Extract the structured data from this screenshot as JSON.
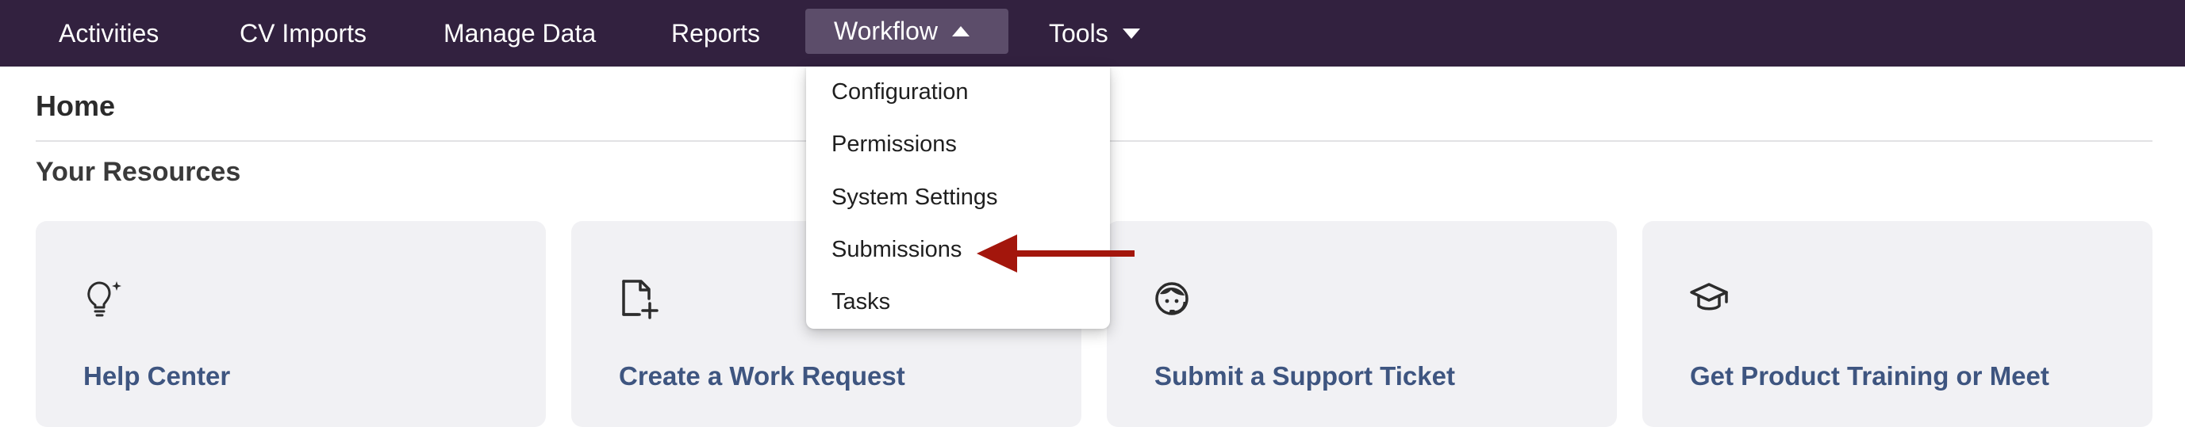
{
  "nav": {
    "items": [
      {
        "label": "Activities"
      },
      {
        "label": "CV Imports"
      },
      {
        "label": "Manage Data"
      },
      {
        "label": "Reports"
      },
      {
        "label": "Workflow"
      },
      {
        "label": "Tools"
      }
    ],
    "active_index": 4,
    "background": "#32213f",
    "active_background": "#5c4d6a"
  },
  "page": {
    "title": "Home",
    "section_title": "Your Resources"
  },
  "workflow_menu": {
    "items": [
      {
        "label": "Configuration"
      },
      {
        "label": "Permissions"
      },
      {
        "label": "System Settings"
      },
      {
        "label": "Submissions"
      },
      {
        "label": "Tasks"
      }
    ],
    "highlighted_item": "Submissions"
  },
  "annotation": {
    "arrow_color": "#a3160c",
    "points_to": "Submissions"
  },
  "cards": [
    {
      "title": "Help Center",
      "icon": "lightbulb-icon"
    },
    {
      "title": "Create a Work Request",
      "icon": "file-plus-icon"
    },
    {
      "title": "Submit a Support Ticket",
      "icon": "support-agent-icon"
    },
    {
      "title": "Get Product Training or Meet",
      "icon": "graduation-cap-icon"
    }
  ],
  "colors": {
    "card_background": "#f1f1f4",
    "card_title": "#3e5580"
  }
}
